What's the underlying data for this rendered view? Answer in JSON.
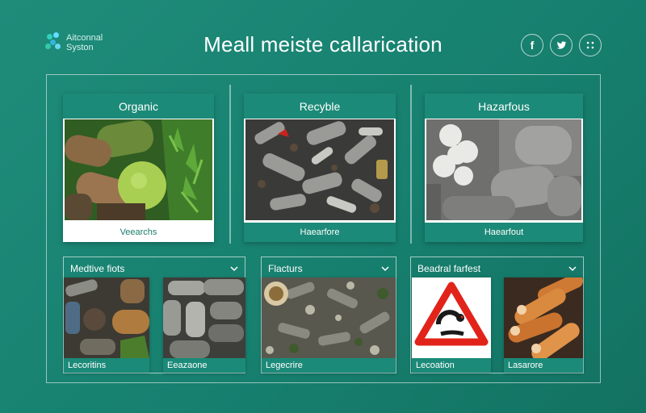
{
  "header": {
    "logo_line1": "Aitconnal",
    "logo_line2": "Syston",
    "title": "Meall meiste callarication",
    "social": [
      {
        "icon": "facebook-icon",
        "label": "f"
      },
      {
        "icon": "twitter-icon",
        "label": ""
      },
      {
        "icon": "share-icon",
        "label": ""
      }
    ]
  },
  "categories": [
    {
      "title": "Organic",
      "footer": "Veearchs"
    },
    {
      "title": "Recyble",
      "footer": "Haearfore"
    },
    {
      "title": "Hazarfous",
      "footer": "Haearfout"
    }
  ],
  "groups": [
    {
      "title": "Medtive fiots",
      "items": [
        "Lecoritins",
        "Eeazaone"
      ]
    },
    {
      "title": "Flacturs",
      "items": [
        "Legecrire"
      ]
    },
    {
      "title": "Beadral farfest",
      "items": [
        "Lecoation",
        "Lasarore"
      ]
    }
  ],
  "colors": {
    "background": "#1a8574",
    "accent": "#1c8a78",
    "hazard_red": "#e2231a"
  }
}
